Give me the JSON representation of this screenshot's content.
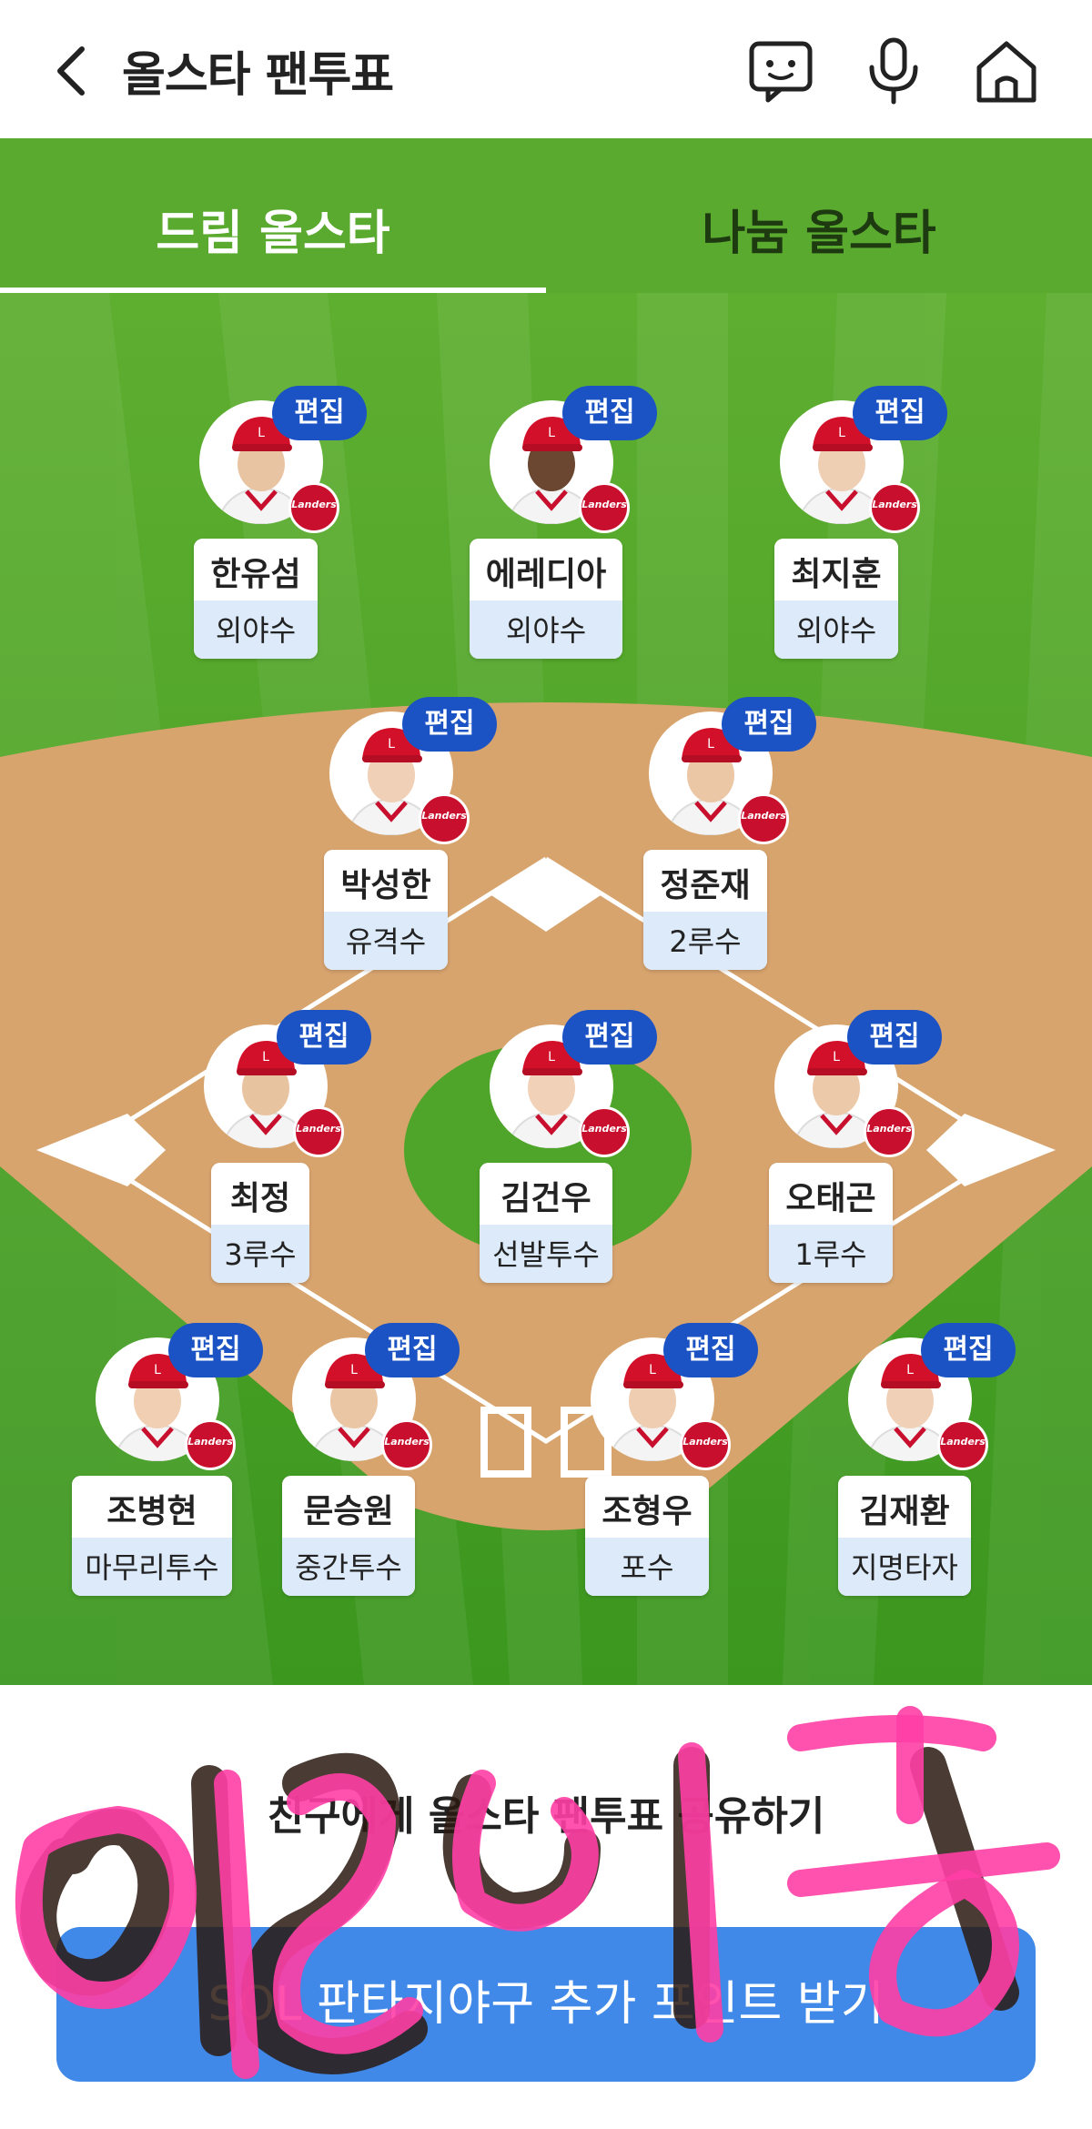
{
  "header": {
    "title": "올스타 팬투표",
    "back_icon": "chevron-left-icon",
    "icons": [
      "chat-icon",
      "microphone-icon",
      "home-icon"
    ]
  },
  "tabs": [
    {
      "label": "드림 올스타",
      "active": true
    },
    {
      "label": "나눔 올스타",
      "active": false
    }
  ],
  "edit_label": "편집",
  "team_logo_text": "Landers",
  "players": [
    {
      "name": "한유섬",
      "position": "외야수"
    },
    {
      "name": "에레디아",
      "position": "외야수"
    },
    {
      "name": "최지훈",
      "position": "외야수"
    },
    {
      "name": "박성한",
      "position": "유격수"
    },
    {
      "name": "정준재",
      "position": "2루수"
    },
    {
      "name": "최정",
      "position": "3루수"
    },
    {
      "name": "김건우",
      "position": "선발투수"
    },
    {
      "name": "오태곤",
      "position": "1루수"
    },
    {
      "name": "조병현",
      "position": "마무리투수"
    },
    {
      "name": "문승원",
      "position": "중간투수"
    },
    {
      "name": "조형우",
      "position": "포수"
    },
    {
      "name": "김재환",
      "position": "지명타자"
    }
  ],
  "share_text": "친구에게 올스타 팬투표 공유하기",
  "cta_label": "SOL 판타지야구 추가 포인트 받기",
  "watermark_text": "여8 두",
  "colors": {
    "grass": "#4fa52a",
    "infield_dirt": "#d8a46e",
    "edit_badge": "#1b53c4",
    "position_bg": "#dceaf9",
    "cta": "#4089e8",
    "watermark": "#ff3ea5"
  }
}
